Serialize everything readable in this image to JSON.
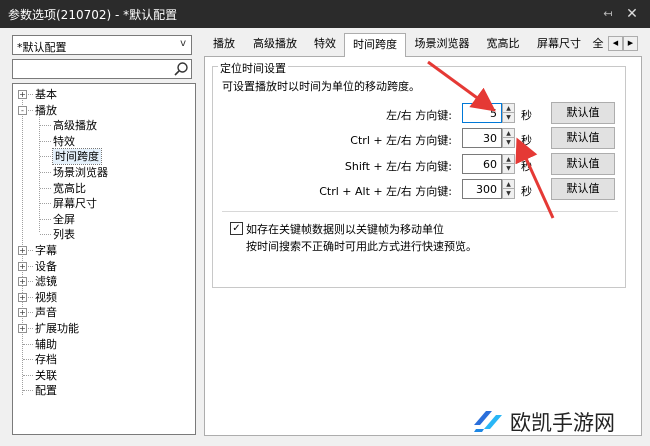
{
  "window": {
    "title": "参数选项(210702) - *默认配置",
    "pin_glyph": "↤",
    "close_glyph": "✕"
  },
  "profile": {
    "selected": "*默认配置",
    "arrow_glyph": "v"
  },
  "search": {
    "value": "",
    "placeholder": ""
  },
  "tree": {
    "items": [
      {
        "label": "基本",
        "level": 0,
        "expander": "+"
      },
      {
        "label": "播放",
        "level": 0,
        "expander": "-"
      },
      {
        "label": "高级播放",
        "level": 1
      },
      {
        "label": "特效",
        "level": 1
      },
      {
        "label": "时间跨度",
        "level": 1,
        "selected": true
      },
      {
        "label": "场景浏览器",
        "level": 1
      },
      {
        "label": "宽高比",
        "level": 1
      },
      {
        "label": "屏幕尺寸",
        "level": 1
      },
      {
        "label": "全屏",
        "level": 1
      },
      {
        "label": "列表",
        "level": 1
      },
      {
        "label": "字幕",
        "level": 0,
        "expander": "+"
      },
      {
        "label": "设备",
        "level": 0,
        "expander": "+"
      },
      {
        "label": "滤镜",
        "level": 0,
        "expander": "+"
      },
      {
        "label": "视频",
        "level": 0,
        "expander": "+"
      },
      {
        "label": "声音",
        "level": 0,
        "expander": "+"
      },
      {
        "label": "扩展功能",
        "level": 0,
        "expander": "+"
      },
      {
        "label": "辅助",
        "level": 0
      },
      {
        "label": "存档",
        "level": 0
      },
      {
        "label": "关联",
        "level": 0
      },
      {
        "label": "配置",
        "level": 0
      }
    ]
  },
  "tabs": [
    {
      "label": "播放"
    },
    {
      "label": "高级播放"
    },
    {
      "label": "特效"
    },
    {
      "label": "时间跨度",
      "active": true
    },
    {
      "label": "场景浏览器"
    },
    {
      "label": "宽高比"
    },
    {
      "label": "屏幕尺寸"
    },
    {
      "label": "全"
    }
  ],
  "tab_scroll": {
    "left": "◀",
    "right": "▶"
  },
  "panel": {
    "group_title": "定位时间设置",
    "description": "可设置播放时以时间为单位的移动跨度。",
    "rows": [
      {
        "label": "左/右 方向键:",
        "value": "5",
        "unit": "秒",
        "button": "默认值"
      },
      {
        "label": "Ctrl + 左/右 方向键:",
        "value": "30",
        "unit": "秒",
        "button": "默认值"
      },
      {
        "label": "Shift + 左/右 方向键:",
        "value": "60",
        "unit": "秒",
        "button": "默认值"
      },
      {
        "label": "Ctrl + Alt + 左/右 方向键:",
        "value": "300",
        "unit": "秒",
        "button": "默认值"
      }
    ],
    "keyframe": {
      "checked": true,
      "check_glyph": "✓",
      "label": "如存在关键帧数据则以关键帧为移动单位",
      "note": "按时间搜索不正确时可用此方式进行快速预览。"
    }
  },
  "spin_glyphs": {
    "up": "▲",
    "down": "▼"
  },
  "watermark": {
    "text": "欧凯手游网"
  },
  "colors": {
    "titlebar": "#2b2b2b",
    "focus": "#0078d7",
    "annotation_arrow": "#e53935"
  }
}
